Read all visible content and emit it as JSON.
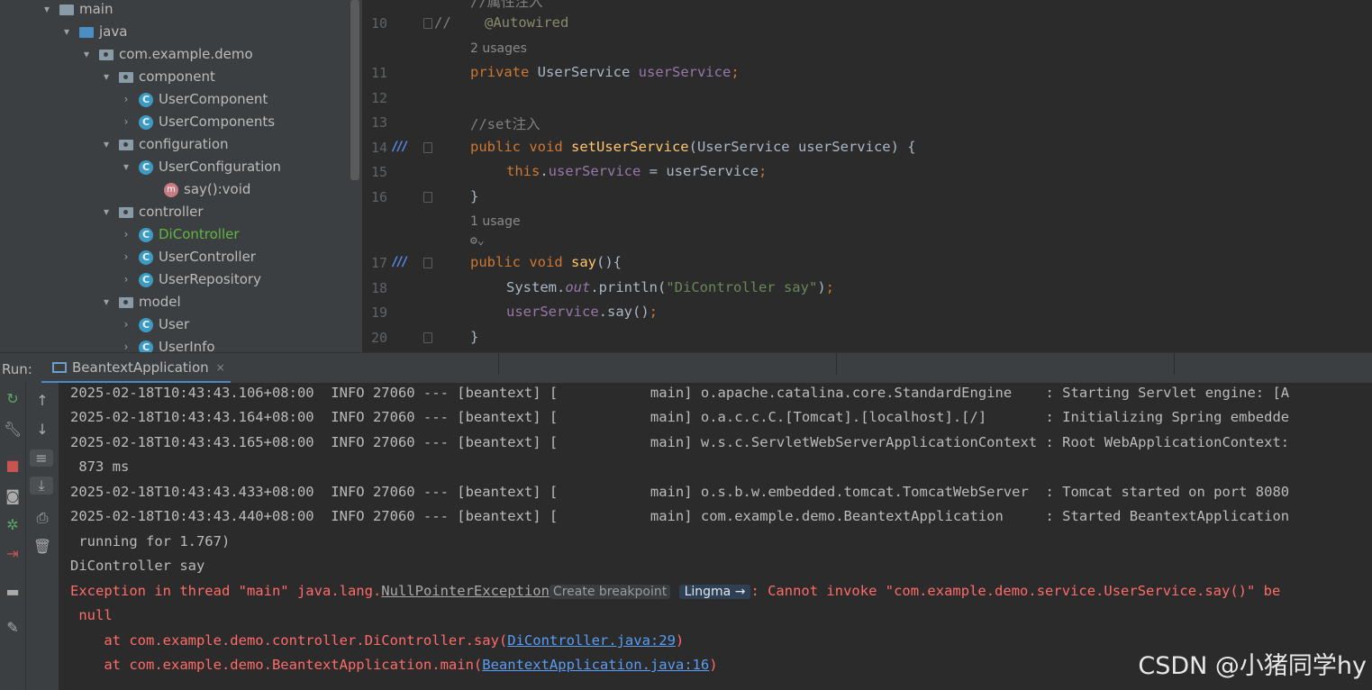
{
  "tree": {
    "items": [
      {
        "label": "main",
        "depth": 0,
        "arrow": "▾",
        "icon": "folder"
      },
      {
        "label": "java",
        "depth": 1,
        "arrow": "▾",
        "icon": "folder-blue"
      },
      {
        "label": "com.example.demo",
        "depth": 2,
        "arrow": "▾",
        "icon": "package"
      },
      {
        "label": "component",
        "depth": 3,
        "arrow": "▾",
        "icon": "package"
      },
      {
        "label": "UserComponent",
        "depth": 4,
        "arrow": "›",
        "icon": "class"
      },
      {
        "label": "UserComponents",
        "depth": 4,
        "arrow": "›",
        "icon": "class"
      },
      {
        "label": "configuration",
        "depth": 3,
        "arrow": "▾",
        "icon": "package"
      },
      {
        "label": "UserConfiguration",
        "depth": 4,
        "arrow": "▾",
        "icon": "class"
      },
      {
        "label": "say():void",
        "depth": 5,
        "arrow": "",
        "icon": "method"
      },
      {
        "label": "controller",
        "depth": 3,
        "arrow": "▾",
        "icon": "package"
      },
      {
        "label": "DiController",
        "depth": 4,
        "arrow": "›",
        "icon": "class",
        "highlight": true
      },
      {
        "label": "UserController",
        "depth": 4,
        "arrow": "›",
        "icon": "class"
      },
      {
        "label": "UserRepository",
        "depth": 4,
        "arrow": "›",
        "icon": "class"
      },
      {
        "label": "model",
        "depth": 3,
        "arrow": "▾",
        "icon": "package"
      },
      {
        "label": "User",
        "depth": 4,
        "arrow": "›",
        "icon": "class"
      },
      {
        "label": "UserInfo",
        "depth": 4,
        "arrow": "›",
        "icon": "class"
      }
    ]
  },
  "editor": {
    "top_comment": "//属性注入",
    "lines": {
      "n10": "10",
      "n11": "11",
      "n12": "12",
      "n13": "13",
      "n14": "14",
      "n15": "15",
      "n16": "16",
      "n17": "17",
      "n18": "18",
      "n19": "19",
      "n20": "20"
    },
    "l10_slashes": "//",
    "l10_annotation": "@Autowired",
    "hint_2usages": "2 usages",
    "l11_kw": "private",
    "l11_type": " UserService ",
    "l11_field": "userService",
    "l11_semi": ";",
    "l13_comment": "//set注入",
    "l14_kw": "public void ",
    "l14_method": "setUserService",
    "l14_rest": "(UserService userService) {",
    "l15_this": "this",
    "l15_dot": ".",
    "l15_field": "userService",
    "l15_rest": " = userService",
    "l15_semi": ";",
    "l16": "}",
    "hint_1usage": "1 usage",
    "l17_kw": "public void ",
    "l17_method": "say",
    "l17_rest": "(){",
    "l18_sys": "System.",
    "l18_out": "out",
    "l18_print": ".println(",
    "l18_str": "\"DiController say\"",
    "l18_end": ")",
    "l18_semi": ";",
    "l19_field": "userService",
    "l19_rest": ".say()",
    "l19_semi": ";",
    "l20": "}"
  },
  "run": {
    "label": "Run:",
    "tab": "BeantextApplication",
    "close": "×"
  },
  "console": {
    "lines": [
      "2025-02-18T10:43:43.106+08:00  INFO 27060 --- [beantext] [           main] o.apache.catalina.core.StandardEngine    : Starting Servlet engine: [A",
      "2025-02-18T10:43:43.164+08:00  INFO 27060 --- [beantext] [           main] o.a.c.c.C.[Tomcat].[localhost].[/]       : Initializing Spring embedde",
      "2025-02-18T10:43:43.165+08:00  INFO 27060 --- [beantext] [           main] w.s.c.ServletWebServerApplicationContext : Root WebApplicationContext:",
      " 873 ms",
      "2025-02-18T10:43:43.433+08:00  INFO 27060 --- [beantext] [           main] o.s.b.w.embedded.tomcat.TomcatWebServer  : Tomcat started on port 8080",
      "2025-02-18T10:43:43.440+08:00  INFO 27060 --- [beantext] [           main] com.example.demo.BeantextApplication     : Started BeantextApplication",
      " running for 1.767)",
      "DiController say"
    ],
    "exception_prefix": "Exception in thread \"main\" java.lang.",
    "exception_class": "NullPointerException",
    "create_breakpoint": "Create breakpoint",
    "lingma": "Lingma →",
    "exception_message": ": Cannot invoke \"com.example.demo.service.UserService.say()\" be",
    "null_line": " null",
    "trace1_prefix": "    at com.example.demo.controller.DiController.say(",
    "trace1_link": "DiController.java:29",
    "trace1_suffix": ")",
    "trace2_prefix": "    at com.example.demo.BeantextApplication.main(",
    "trace2_link": "BeantextApplication.java:16",
    "trace2_suffix": ")"
  },
  "watermark": "CSDN @小猪同学hy",
  "colors": {
    "keyword": "#cc7832",
    "field": "#9876aa",
    "method": "#ffc66d",
    "error": "#ff6b68",
    "link": "#589df6"
  }
}
